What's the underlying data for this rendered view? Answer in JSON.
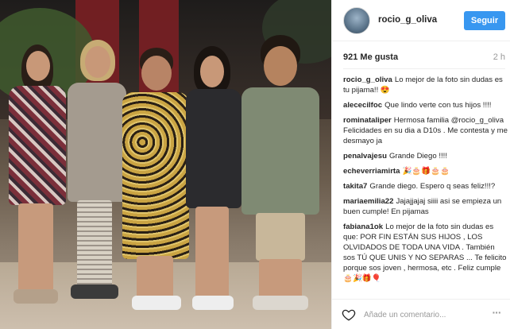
{
  "header": {
    "username": "rocio_g_oliva",
    "follow_label": "Seguir"
  },
  "stats": {
    "likes": "921 Me gusta",
    "time": "2 h"
  },
  "comments": [
    {
      "user": "rocio_g_oliva",
      "text": "Lo mejor de la foto sin dudas es tu pijama!! 😍"
    },
    {
      "user": "alececilfoc",
      "text": "Que lindo verte con tus hijos !!!!"
    },
    {
      "user": "rominataliper",
      "text": "Hermosa familia @rocio_g_oliva Felicidades en su dia a D10s . Me contesta y me desmayo ja"
    },
    {
      "user": "penalvajesu",
      "text": "Grande Diego !!!!"
    },
    {
      "user": "echeverriamirta",
      "text": "🎉🎂🎁🎂🎂"
    },
    {
      "user": "takita7",
      "text": "Grande diego. Espero q seas feliz!!!?"
    },
    {
      "user": "mariaemilia22",
      "text": "Jajajjajaj siiii asi se empieza un buen cumple! En pijamas"
    },
    {
      "user": "fabiana1ok",
      "text": "Lo mejor de la foto sin dudas es que: POR FIN ESTÁN SUS HIJOS , LOS OLVIDADOS DE TODA UNA VIDA . También sos TÚ QUE UNIS Y NO SEPARAS ... Te felicito porque sos joven , hermosa, etc . Feliz cumple 🎂🎉🎁🎈"
    }
  ],
  "footer": {
    "comment_placeholder": "Añade un comentario...",
    "more_label": "···"
  },
  "colors": {
    "accent": "#3897f0",
    "muted": "#999999",
    "text": "#262626",
    "border": "#efefef"
  },
  "icons": {
    "like": "heart-icon",
    "more": "more-options-icon"
  }
}
